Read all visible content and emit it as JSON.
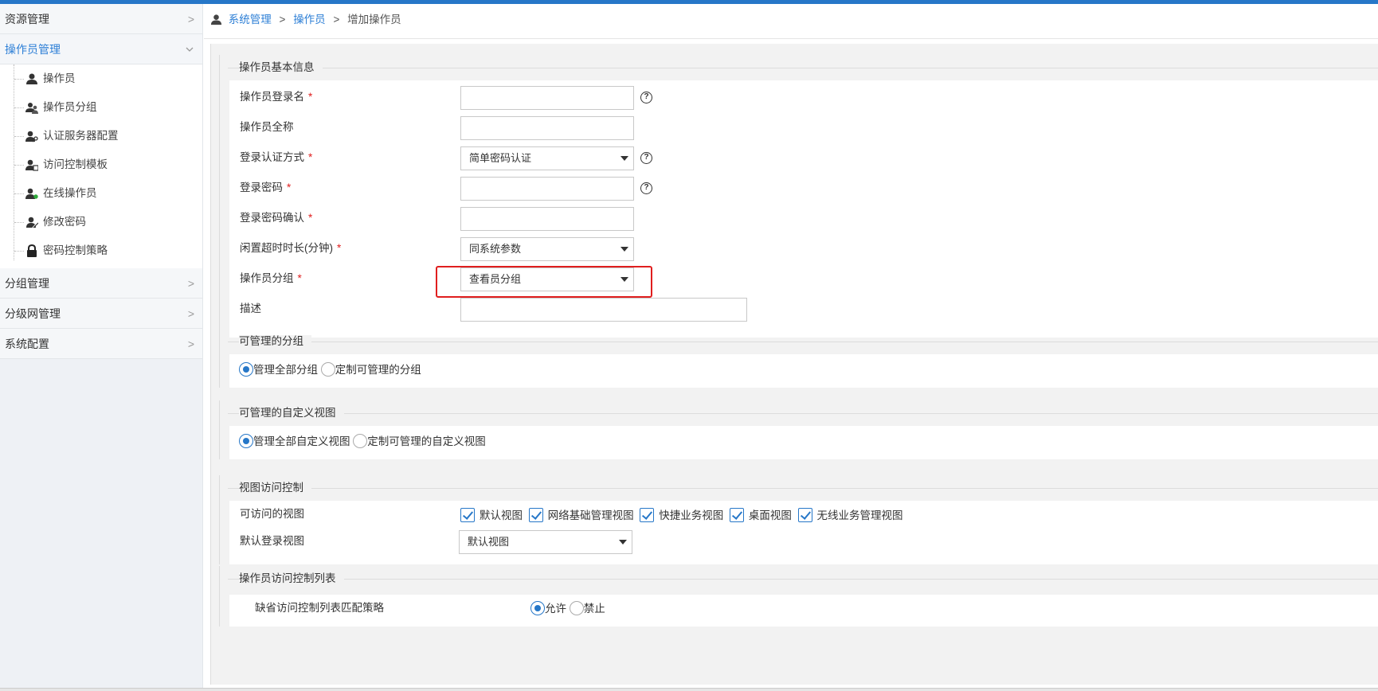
{
  "sidebar": {
    "resource_mgmt": "资源管理",
    "operator_mgmt": "操作员管理",
    "sub_items": [
      "操作员",
      "操作员分组",
      "认证服务器配置",
      "访问控制模板",
      "在线操作员",
      "修改密码",
      "密码控制策略"
    ],
    "group_mgmt": "分组管理",
    "hier_net_mgmt": "分级网管理",
    "sys_config": "系统配置",
    "chevron": ">"
  },
  "breadcrumb": {
    "item1": "系统管理",
    "item2": "操作员",
    "item3": "增加操作员",
    "sep": ">"
  },
  "basic": {
    "title": "操作员基本信息",
    "login_name": "操作员登录名",
    "full_name": "操作员全称",
    "auth_mode": "登录认证方式",
    "auth_mode_value": "简单密码认证",
    "password": "登录密码",
    "password_confirm": "登录密码确认",
    "idle_timeout": "闲置超时时长(分钟)",
    "idle_timeout_value": "同系统参数",
    "group": "操作员分组",
    "group_value": "查看员分组",
    "desc": "描述",
    "required": "*",
    "help": "?"
  },
  "manageable_groups": {
    "title": "可管理的分组",
    "opt_all": "管理全部分组",
    "opt_custom": "定制可管理的分组"
  },
  "manageable_views": {
    "title": "可管理的自定义视图",
    "opt_all": "管理全部自定义视图",
    "opt_custom": "定制可管理的自定义视图"
  },
  "view_access": {
    "title": "视图访问控制",
    "accessible_label": "可访问的视图",
    "views": [
      "默认视图",
      "网络基础管理视图",
      "快捷业务视图",
      "桌面视图",
      "无线业务管理视图"
    ],
    "default_label": "默认登录视图",
    "default_value": "默认视图"
  },
  "acl": {
    "title": "操作员访问控制列表",
    "policy_label": "缺省访问控制列表匹配策略",
    "allow": "允许",
    "deny": "禁止"
  },
  "colors": {
    "accent": "#2677c8",
    "highlight": "#e01e1e",
    "required": "#e02020"
  }
}
